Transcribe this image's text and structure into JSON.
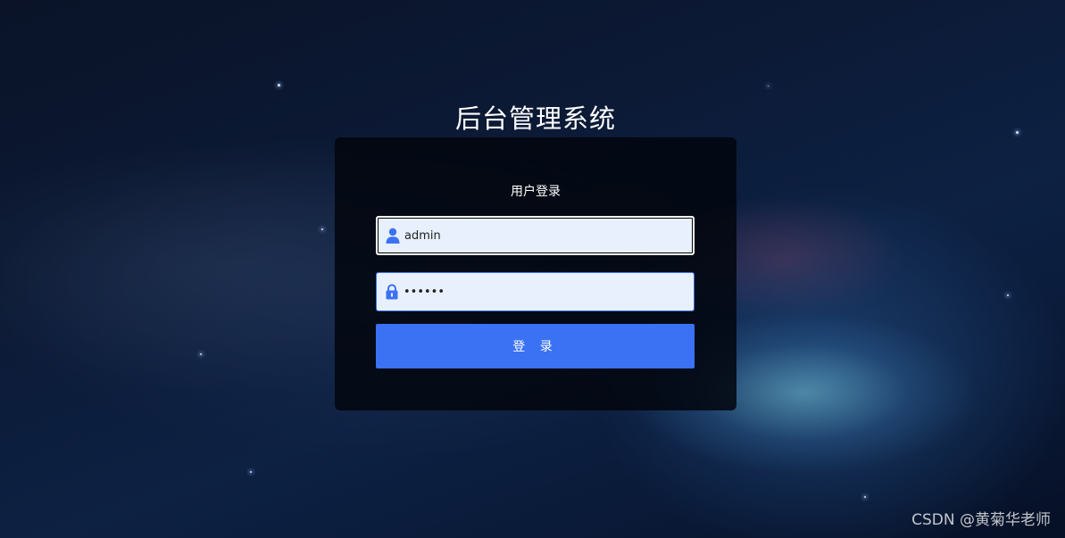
{
  "page": {
    "title": "后台管理系统",
    "watermark": "CSDN @黄菊华老师"
  },
  "login_form": {
    "heading": "用户登录",
    "username": {
      "value": "admin",
      "icon": "user-icon"
    },
    "password": {
      "value": "123456",
      "icon": "lock-icon"
    },
    "submit_label": "登 录"
  },
  "colors": {
    "button": "#3b72f4",
    "input_background": "#e8f0fe",
    "icon": "#3b72f4",
    "card_background": "#02060e"
  }
}
